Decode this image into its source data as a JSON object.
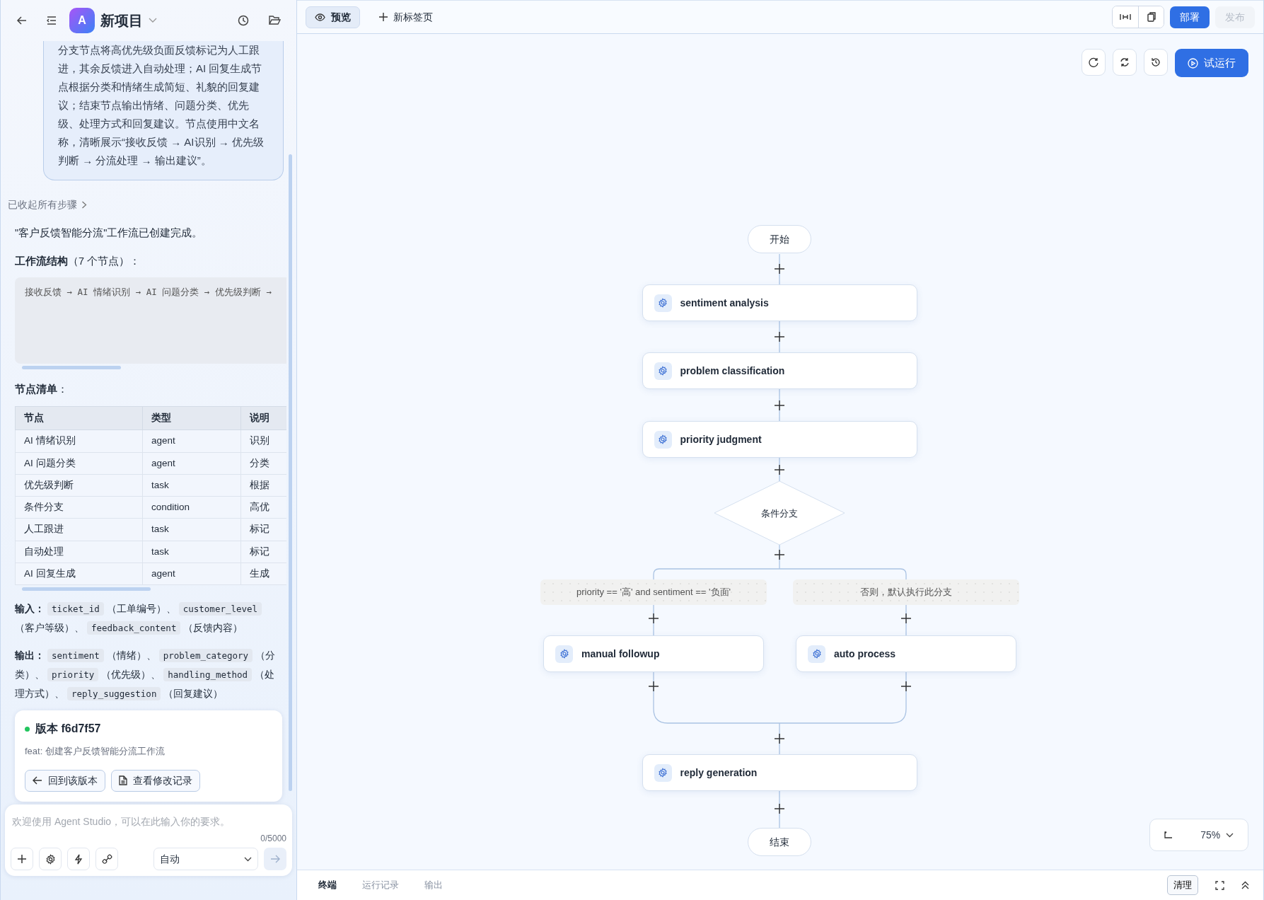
{
  "header": {
    "avatar_letter": "A",
    "project_name": "新项目"
  },
  "chat": {
    "user_message": "分支节点将高优先级负面反馈标记为人工跟进，其余反馈进入自动处理；AI 回复生成节点根据分类和情绪生成简短、礼貌的回复建议；结束节点输出情绪、问题分类、优先级、处理方式和回复建议。节点使用中文名称，清晰展示“接收反馈 → AI识别 → 优先级判断 → 分流处理 → 输出建议”。",
    "steps_toggle": "已收起所有步骤",
    "intro": "\"客户反馈智能分流\"工作流已创建完成。",
    "structure_heading": "**工作流结构**（7 个节点）：",
    "structure_code": "接收反馈 → AI 情绪识别 → AI 问题分类 → 优先级判断 →",
    "nodes_heading": "**节点清单**：",
    "table": {
      "columns": [
        "节点",
        "类型",
        "说明"
      ],
      "rows": [
        [
          "AI 情绪识别",
          "agent",
          "识别"
        ],
        [
          "AI 问题分类",
          "agent",
          "分类"
        ],
        [
          "优先级判断",
          "task",
          "根据"
        ],
        [
          "条件分支",
          "condition",
          "高优"
        ],
        [
          "人工跟进",
          "task",
          "标记"
        ],
        [
          "自动处理",
          "task",
          "标记"
        ],
        [
          "AI 回复生成",
          "agent",
          "生成"
        ]
      ]
    },
    "io": [
      {
        "label": "输入：",
        "items": [
          {
            "code": "ticket_id",
            "note": "（工单编号）、"
          },
          {
            "code": "customer_level",
            "note": "（客户等级）、"
          },
          {
            "code": "feedback_content",
            "note": "（反馈内容）"
          }
        ]
      },
      {
        "label": "输出：",
        "items": [
          {
            "code": "sentiment",
            "note": "（情绪）、"
          },
          {
            "code": "problem_category",
            "note": "（分类）、"
          },
          {
            "code": "priority",
            "note": "（优先级）、"
          },
          {
            "code": "handling_method",
            "note": "（处理方式）、"
          },
          {
            "code": "reply_suggestion",
            "note": "（回复建议）"
          }
        ]
      }
    ],
    "version_card": {
      "title": "版本 f6d7f57",
      "message": "feat: 创建客户反馈智能分流工作流",
      "buttons": [
        "回到该版本",
        "查看修改记录"
      ]
    }
  },
  "composer": {
    "placeholder": "欢迎使用 Agent Studio，可以在此输入你的要求。",
    "counter": "0/5000",
    "mode": "自动"
  },
  "tabs": [
    {
      "label": "预览",
      "selected": true
    }
  ],
  "new_tab_button": "新标签页",
  "top_actions": {
    "deploy": "部署",
    "publish": "发布",
    "publish_disabled": true
  },
  "run_button": "试运行",
  "flow": {
    "start": "开始",
    "steps": [
      "sentiment analysis",
      "problem classification",
      "priority judgment"
    ],
    "condition": "条件分支",
    "branches": [
      {
        "condition": "priority == '高' and sentiment == '负面'",
        "node": "manual followup"
      },
      {
        "condition": "否则，默认执行此分支",
        "node": "auto process"
      }
    ],
    "merge_node": "reply generation",
    "end": "结束"
  },
  "zoom_level": "75%",
  "bottom_tabs": [
    {
      "label": "终端",
      "selected": true
    },
    {
      "label": "运行记录",
      "selected": false
    },
    {
      "label": "输出",
      "selected": false
    }
  ],
  "clear_button": "清理"
}
